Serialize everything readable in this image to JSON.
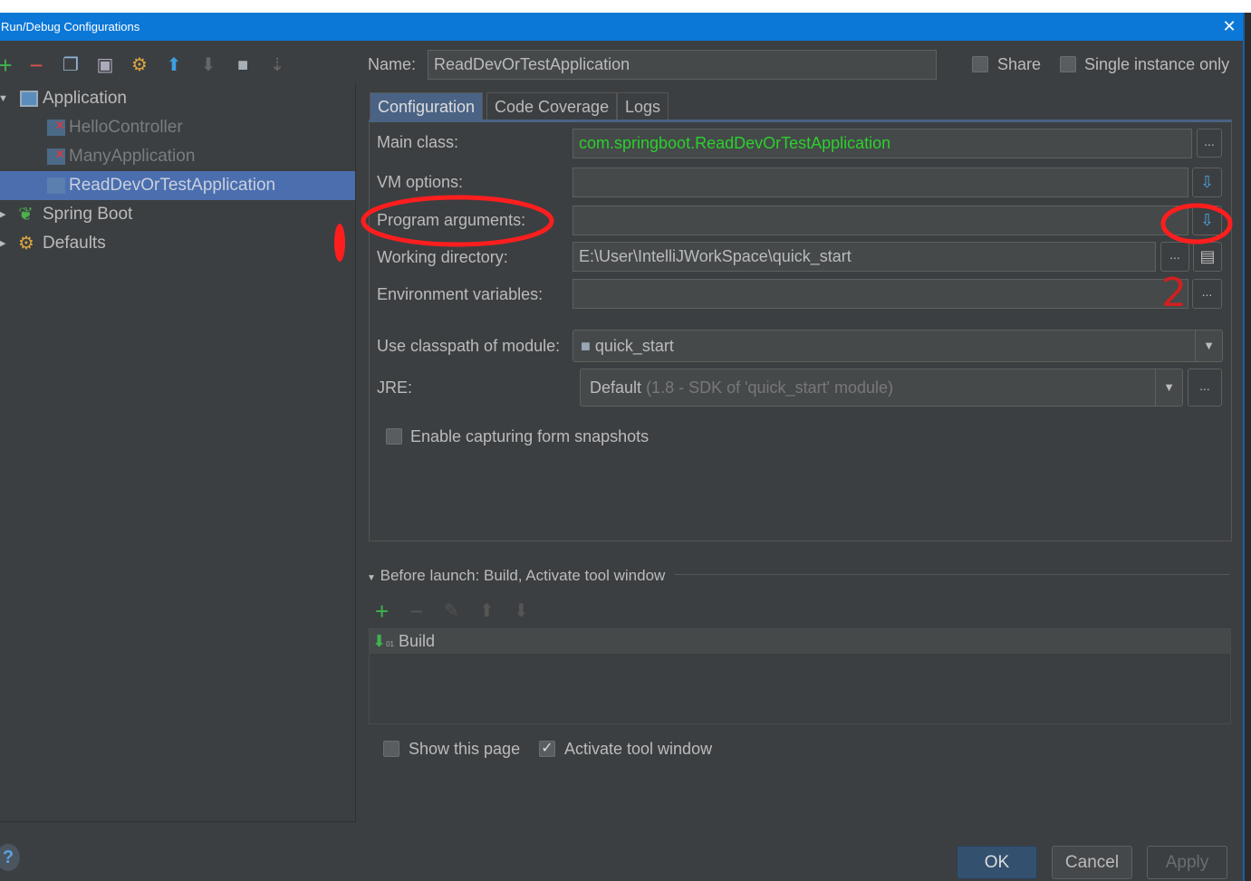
{
  "window": {
    "title": "Run/Debug Configurations",
    "close_icon": "close-icon"
  },
  "toolbar": {
    "icons": [
      "add-icon",
      "remove-icon",
      "copy-icon",
      "save-icon",
      "edit-defaults-icon",
      "move-up-icon",
      "move-down-icon",
      "folder-icon",
      "sort-icon"
    ]
  },
  "tree": {
    "items": [
      {
        "label": "Application",
        "level": 0,
        "expanded": true
      },
      {
        "label": "HelloController",
        "level": 1,
        "error": true
      },
      {
        "label": "ManyApplication",
        "level": 1,
        "error": true
      },
      {
        "label": "ReadDevOrTestApplication",
        "level": 1,
        "selected": true
      },
      {
        "label": "Spring Boot",
        "level": 0,
        "expanded": false
      },
      {
        "label": "Defaults",
        "level": 0,
        "expanded": false
      }
    ]
  },
  "header": {
    "name_label": "Name:",
    "name_value": "ReadDevOrTestApplication",
    "share_label": "Share",
    "share_checked": false,
    "single_label": "Single instance only",
    "single_checked": false
  },
  "tabs": [
    {
      "label": "Configuration",
      "selected": true
    },
    {
      "label": "Code Coverage"
    },
    {
      "label": "Logs"
    }
  ],
  "config": {
    "main_class_label": "Main class:",
    "main_class_value": "com.springboot.ReadDevOrTestApplication",
    "vm_label": "VM options:",
    "vm_value": "",
    "program_label": "Program arguments:",
    "program_value": "",
    "workdir_label": "Working directory:",
    "workdir_value": "E:\\User\\IntelliJWorkSpace\\quick_start",
    "env_label": "Environment variables:",
    "env_value": "",
    "classpath_label": "Use classpath of module:",
    "classpath_value": "quick_start",
    "jre_label": "JRE:",
    "jre_value": "Default",
    "jre_detail": "(1.8 - SDK of 'quick_start' module)",
    "snapshots_label": "Enable capturing form snapshots",
    "snapshots_checked": false,
    "ellipsis": "..."
  },
  "before_launch": {
    "title": "Before launch: Build, Activate tool window",
    "items": [
      "Build"
    ],
    "show_page_label": "Show this page",
    "show_page_checked": false,
    "activate_label": "Activate tool window",
    "activate_checked": true
  },
  "buttons": {
    "ok": "OK",
    "cancel": "Cancel",
    "apply": "Apply",
    "help": "?"
  },
  "annotations": {
    "color": "#ff1e1e",
    "handwritten": "2"
  },
  "colors": {
    "title_bar": "#0b78d7",
    "background": "#3c3f41",
    "selection": "#4b6eaf",
    "main_class_text": "#2bd02b"
  }
}
